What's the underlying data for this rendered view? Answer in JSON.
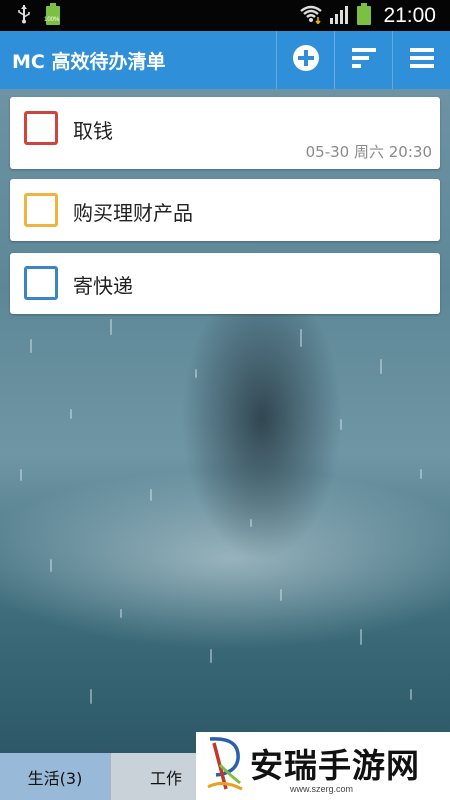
{
  "status_bar": {
    "time": "21:00",
    "battery_label": "100%",
    "icons": [
      "usb-icon",
      "battery-icon",
      "wifi-icon",
      "signal-icon",
      "battery-full-icon"
    ]
  },
  "app_bar": {
    "title": "MC 高效待办清单",
    "actions": [
      "add-icon",
      "sort-icon",
      "menu-icon"
    ],
    "color": "#2f8fd8"
  },
  "tasks": [
    {
      "title": "取钱",
      "meta": "05-30 周六 20:30",
      "color": "#d0443e"
    },
    {
      "title": "购买理财产品",
      "meta": "",
      "color": "#efb43f"
    },
    {
      "title": "寄快递",
      "meta": "",
      "color": "#3a85c8"
    }
  ],
  "tabs": [
    {
      "label": "生活(3)",
      "active": true
    },
    {
      "label": "工作",
      "active": false
    }
  ],
  "watermark": {
    "text": "安瑞手游网",
    "url": "www.szerg.com"
  }
}
